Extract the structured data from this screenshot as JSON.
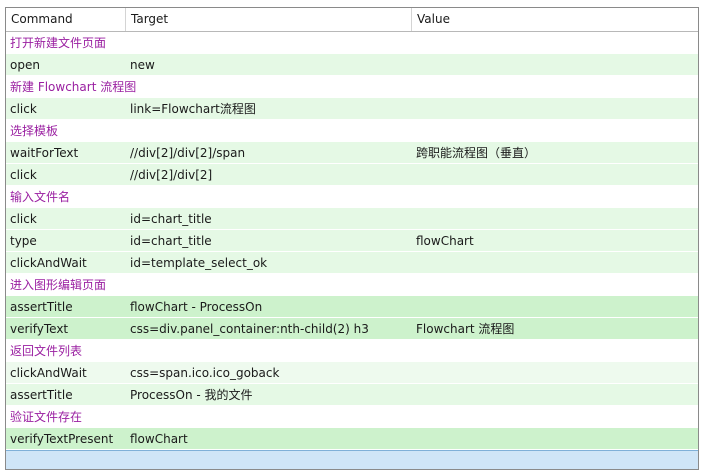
{
  "columns": [
    "Command",
    "Target",
    "Value"
  ],
  "rows": [
    {
      "type": "comment",
      "text": "打开新建文件页面"
    },
    {
      "type": "cmd",
      "command": "open",
      "target": "new",
      "value": ""
    },
    {
      "type": "comment",
      "text": "新建 Flowchart 流程图"
    },
    {
      "type": "cmd",
      "command": "click",
      "target": "link=Flowchart流程图",
      "value": ""
    },
    {
      "type": "comment",
      "text": "选择模板"
    },
    {
      "type": "cmd",
      "command": "waitForText",
      "target": "//div[2]/div[2]/span",
      "value": "跨职能流程图（垂直）"
    },
    {
      "type": "cmd",
      "command": "click",
      "target": "//div[2]/div[2]",
      "value": ""
    },
    {
      "type": "comment",
      "text": "输入文件名"
    },
    {
      "type": "cmd",
      "command": "click",
      "target": "id=chart_title",
      "value": ""
    },
    {
      "type": "cmd",
      "command": "type",
      "target": "id=chart_title",
      "value": "flowChart"
    },
    {
      "type": "cmd",
      "command": "clickAndWait",
      "target": "id=template_select_ok",
      "value": ""
    },
    {
      "type": "comment",
      "text": "进入图形编辑页面"
    },
    {
      "type": "pass",
      "command": "assertTitle",
      "target": "flowChart - ProcessOn",
      "value": ""
    },
    {
      "type": "pass",
      "command": "verifyText",
      "target": "css=div.panel_container:nth-child(2) h3",
      "value": "Flowchart 流程图"
    },
    {
      "type": "comment",
      "text": "返回文件列表"
    },
    {
      "type": "plain",
      "command": "clickAndWait",
      "target": "css=span.ico.ico_goback",
      "value": ""
    },
    {
      "type": "cmd",
      "command": "assertTitle",
      "target": "ProcessOn - 我的文件",
      "value": ""
    },
    {
      "type": "comment",
      "text": "验证文件存在"
    },
    {
      "type": "pass",
      "command": "verifyTextPresent",
      "target": "flowChart",
      "value": ""
    }
  ]
}
